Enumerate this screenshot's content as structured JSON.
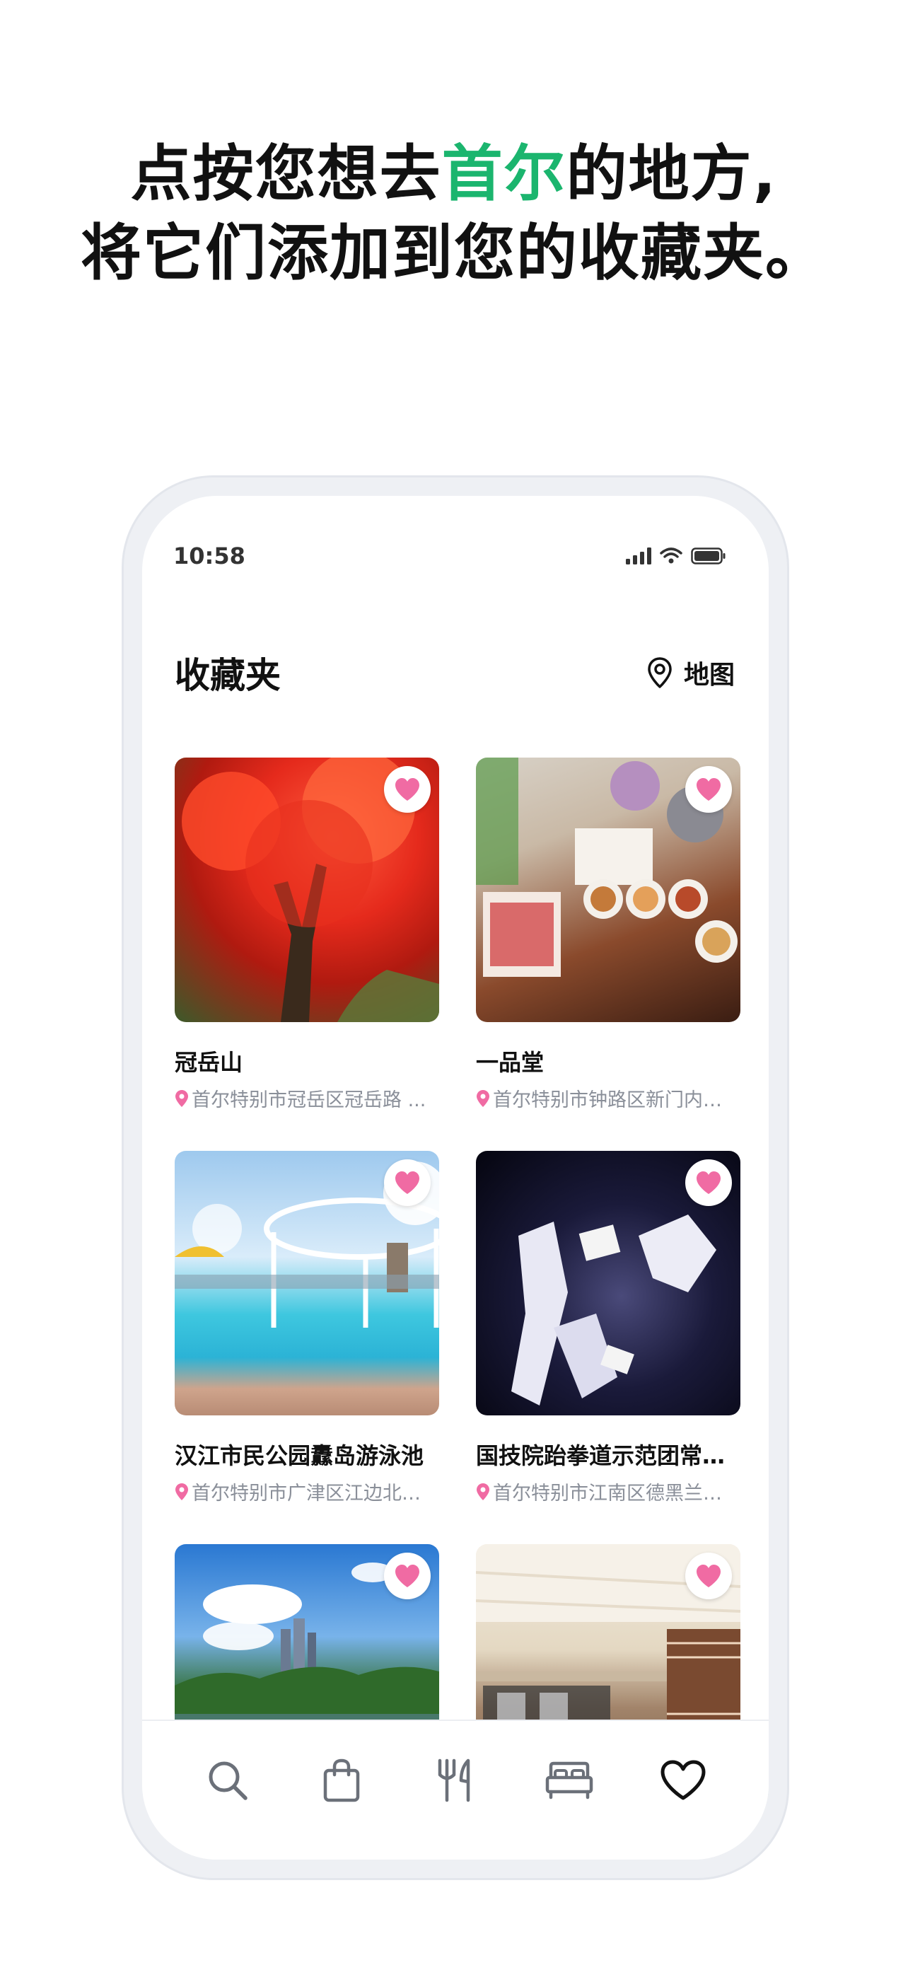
{
  "headline": {
    "line1_pre": "点按您想去",
    "line1_highlight": "首尔",
    "line1_post": "的地方,",
    "line2": "将它们添加到您的收藏夹。"
  },
  "status_bar": {
    "time": "10:58"
  },
  "header": {
    "title": "收藏夹",
    "map_label": "地图"
  },
  "favorites": [
    {
      "name": "冠岳山",
      "address": "首尔特别市冠岳区冠岳路 ..."
    },
    {
      "name": "一品堂",
      "address": "首尔特别市钟路区新门内…"
    },
    {
      "name": "汉江市民公园纛岛游泳池",
      "address": "首尔特别市广津区江边北…"
    },
    {
      "name": "国技院跆拳道示范团常…",
      "address": "首尔特别市江南区德黑兰…"
    },
    {
      "name": "",
      "address": ""
    },
    {
      "name": "",
      "address": ""
    }
  ],
  "tabbar": [
    "search-icon",
    "shopping-bag-icon",
    "fork-knife-icon",
    "bed-icon",
    "heart-icon"
  ],
  "colors": {
    "accent_green": "#1bb56e",
    "favorite_pink": "#f06ba3",
    "gray_text": "#8a8f99"
  }
}
